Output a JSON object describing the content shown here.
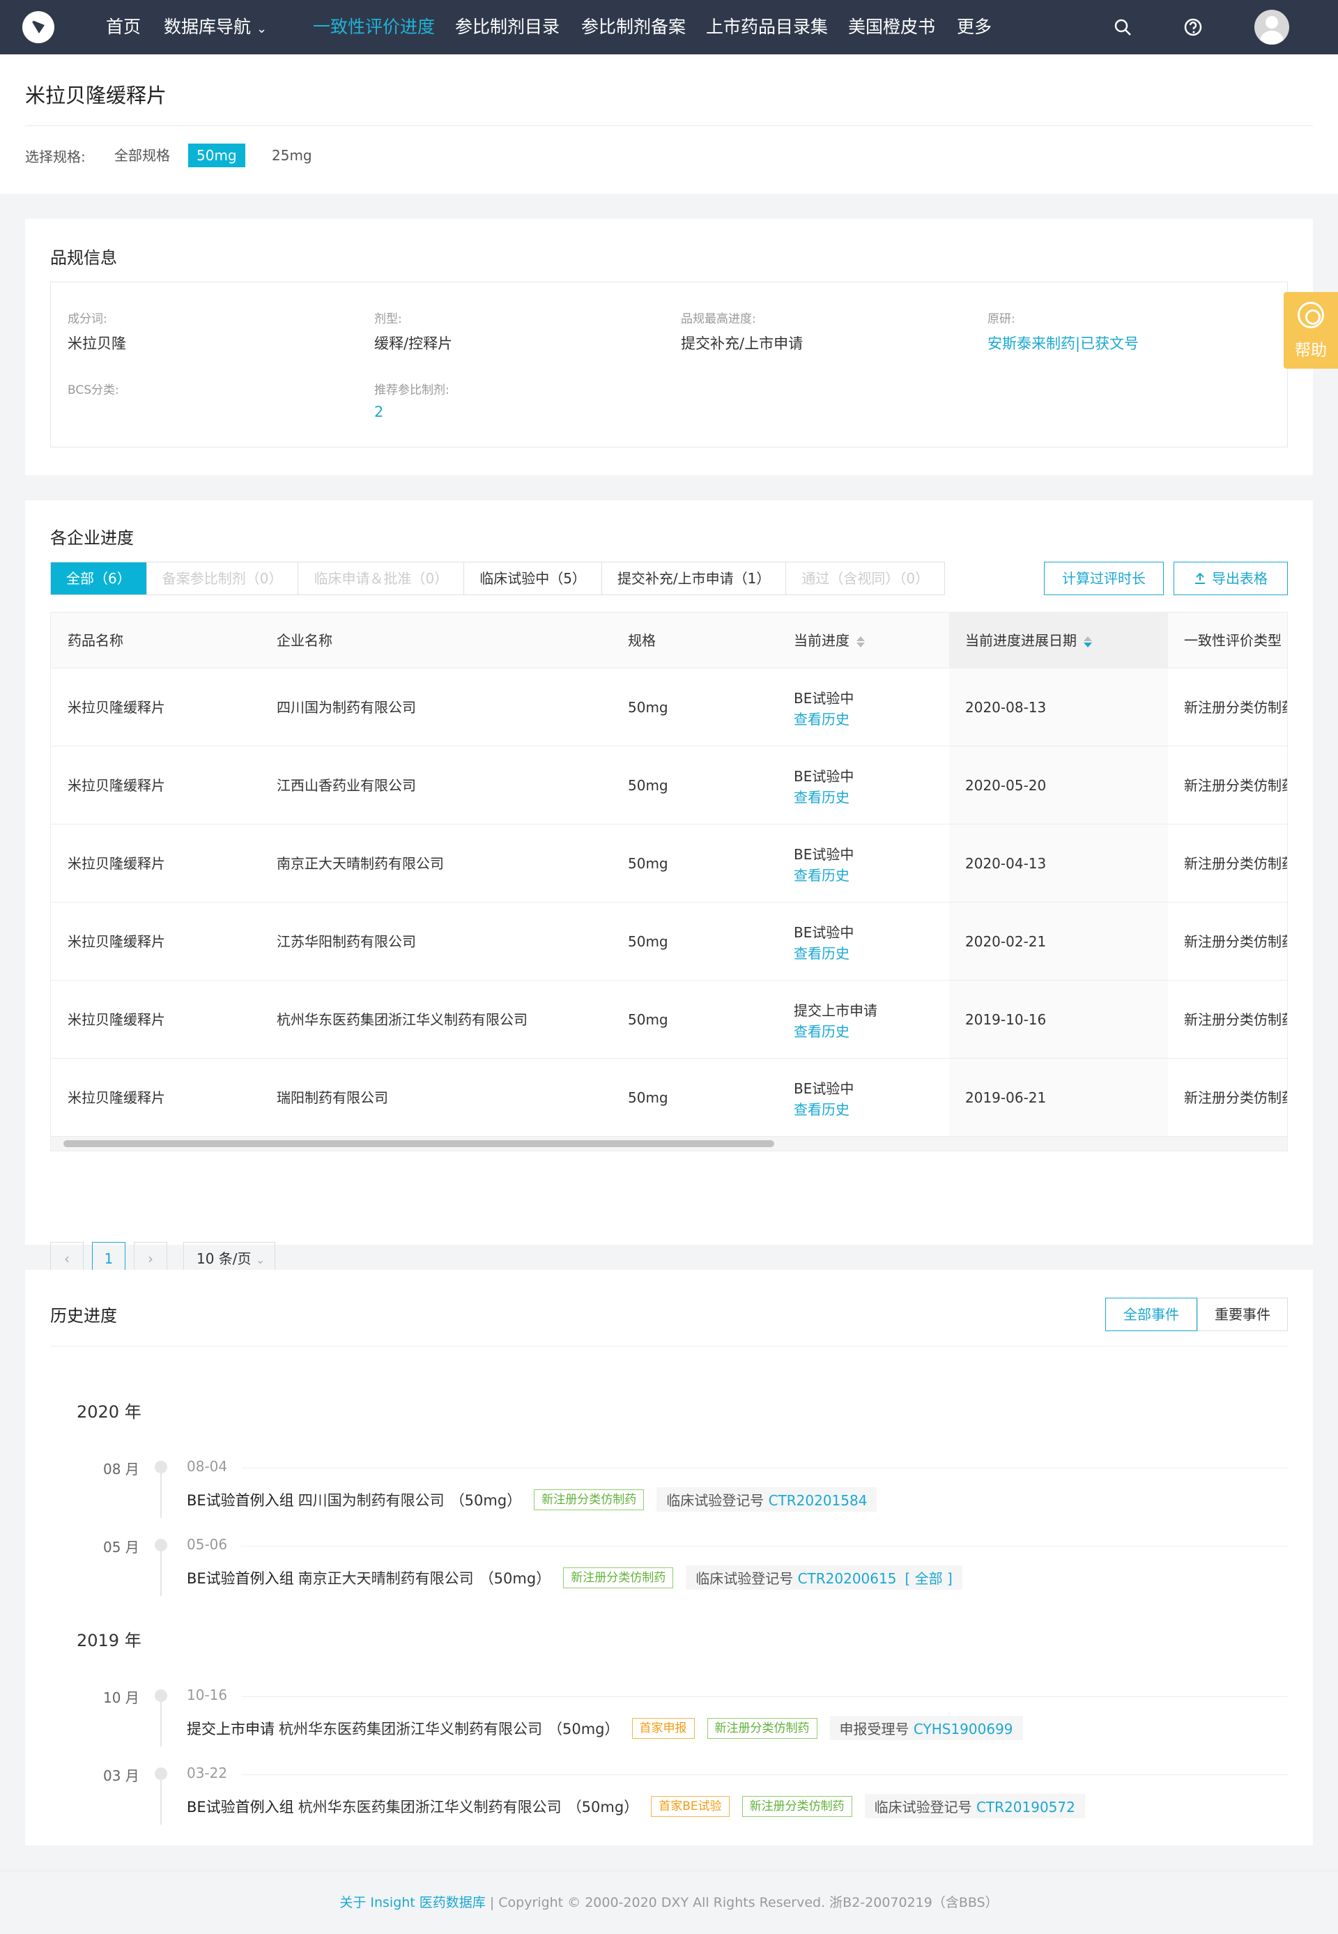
{
  "nav": {
    "items": [
      "首页",
      "数据库导航",
      "一致性评价进度",
      "参比制剂目录",
      "参比制剂备案",
      "上市药品目录集",
      "美国橙皮书",
      "更多"
    ],
    "dropdown_caret": "⌄",
    "help_label": "帮助"
  },
  "header": {
    "title": "米拉贝隆缓释片",
    "spec_label": "选择规格:",
    "spec_options": [
      "全部规格",
      "50mg",
      "25mg"
    ]
  },
  "info": {
    "title": "品规信息",
    "fields": [
      {
        "label": "成分词:",
        "value": "米拉贝隆"
      },
      {
        "label": "剂型:",
        "value": "缓释/控释片"
      },
      {
        "label": "品规最高进度:",
        "value": "提交补充/上市申请"
      },
      {
        "label": "原研:",
        "value": "安斯泰来制药|已获文号"
      },
      {
        "label": "BCS分类:",
        "value": ""
      },
      {
        "label": "推荐参比制剂:",
        "value": "2"
      }
    ]
  },
  "progress": {
    "title": "各企业进度",
    "tabs": [
      "全部（6）",
      "备案参比制剂（0）",
      "临床申请＆批准（0）",
      "临床试验中（5）",
      "提交补充/上市申请（1）",
      "通过（含视同）（0）"
    ],
    "calc_button": "计算过评时长",
    "export_button": "导出表格",
    "columns": [
      "药品名称",
      "企业名称",
      "规格",
      "当前进度",
      "当前进度进展日期",
      "一致性评价类型"
    ],
    "history_link": "查看历史",
    "rows": [
      {
        "drug": "米拉贝隆缓释片",
        "company": "四川国为制药有限公司",
        "spec": "50mg",
        "stage": "BE试验中",
        "date": "2020-08-13",
        "type": "新注册分类仿制药"
      },
      {
        "drug": "米拉贝隆缓释片",
        "company": "江西山香药业有限公司",
        "spec": "50mg",
        "stage": "BE试验中",
        "date": "2020-05-20",
        "type": "新注册分类仿制药"
      },
      {
        "drug": "米拉贝隆缓释片",
        "company": "南京正大天晴制药有限公司",
        "spec": "50mg",
        "stage": "BE试验中",
        "date": "2020-04-13",
        "type": "新注册分类仿制药"
      },
      {
        "drug": "米拉贝隆缓释片",
        "company": "江苏华阳制药有限公司",
        "spec": "50mg",
        "stage": "BE试验中",
        "date": "2020-02-21",
        "type": "新注册分类仿制药"
      },
      {
        "drug": "米拉贝隆缓释片",
        "company": "杭州华东医药集团浙江华义制药有限公司",
        "spec": "50mg",
        "stage": "提交上市申请",
        "date": "2019-10-16",
        "type": "新注册分类仿制药"
      },
      {
        "drug": "米拉贝隆缓释片",
        "company": "瑞阳制药有限公司",
        "spec": "50mg",
        "stage": "BE试验中",
        "date": "2019-06-21",
        "type": "新注册分类仿制药"
      }
    ],
    "pager": {
      "prev": "‹",
      "current": "1",
      "next": "›",
      "page_size": "10 条/页"
    }
  },
  "history": {
    "title": "历史进度",
    "filters": [
      "全部事件",
      "重要事件"
    ],
    "years": [
      {
        "year": "2020 年",
        "events": [
          {
            "month": "08 月",
            "date": "08-04",
            "name": "BE试验首例入组",
            "company": "四川国为制药有限公司",
            "spec": "（50mg）",
            "tags": [
              {
                "text": "新注册分类仿制药",
                "color": "green"
              }
            ],
            "reg_label": "临床试验登记号",
            "reg_no": "CTR20201584",
            "extra": ""
          },
          {
            "month": "05 月",
            "date": "05-06",
            "name": "BE试验首例入组",
            "company": "南京正大天晴制药有限公司",
            "spec": "（50mg）",
            "tags": [
              {
                "text": "新注册分类仿制药",
                "color": "green"
              }
            ],
            "reg_label": "临床试验登记号",
            "reg_no": "CTR20200615",
            "extra": "[ 全部 ]"
          }
        ]
      },
      {
        "year": "2019 年",
        "events": [
          {
            "month": "10 月",
            "date": "10-16",
            "name": "提交上市申请",
            "company": "杭州华东医药集团浙江华义制药有限公司",
            "spec": "（50mg）",
            "tags": [
              {
                "text": "首家申报",
                "color": "orange"
              },
              {
                "text": "新注册分类仿制药",
                "color": "green"
              }
            ],
            "reg_label": "申报受理号",
            "reg_no": "CYHS1900699",
            "extra": ""
          },
          {
            "month": "03 月",
            "date": "03-22",
            "name": "BE试验首例入组",
            "company": "杭州华东医药集团浙江华义制药有限公司",
            "spec": "（50mg）",
            "tags": [
              {
                "text": "首家BE试验",
                "color": "orange"
              },
              {
                "text": "新注册分类仿制药",
                "color": "green"
              }
            ],
            "reg_label": "临床试验登记号",
            "reg_no": "CTR20190572",
            "extra": ""
          }
        ]
      }
    ]
  },
  "footer": {
    "about_link": "关于 Insight 医药数据库",
    "copyright": " | Copyright © 2000-2020 DXY All Rights Reserved. 浙B2-20070219（含BBS）"
  },
  "colors": {
    "nav_bg": "#30394b",
    "accent": "#0ab3d6",
    "link": "#1ba8d3",
    "help_bg": "#f8c655"
  }
}
